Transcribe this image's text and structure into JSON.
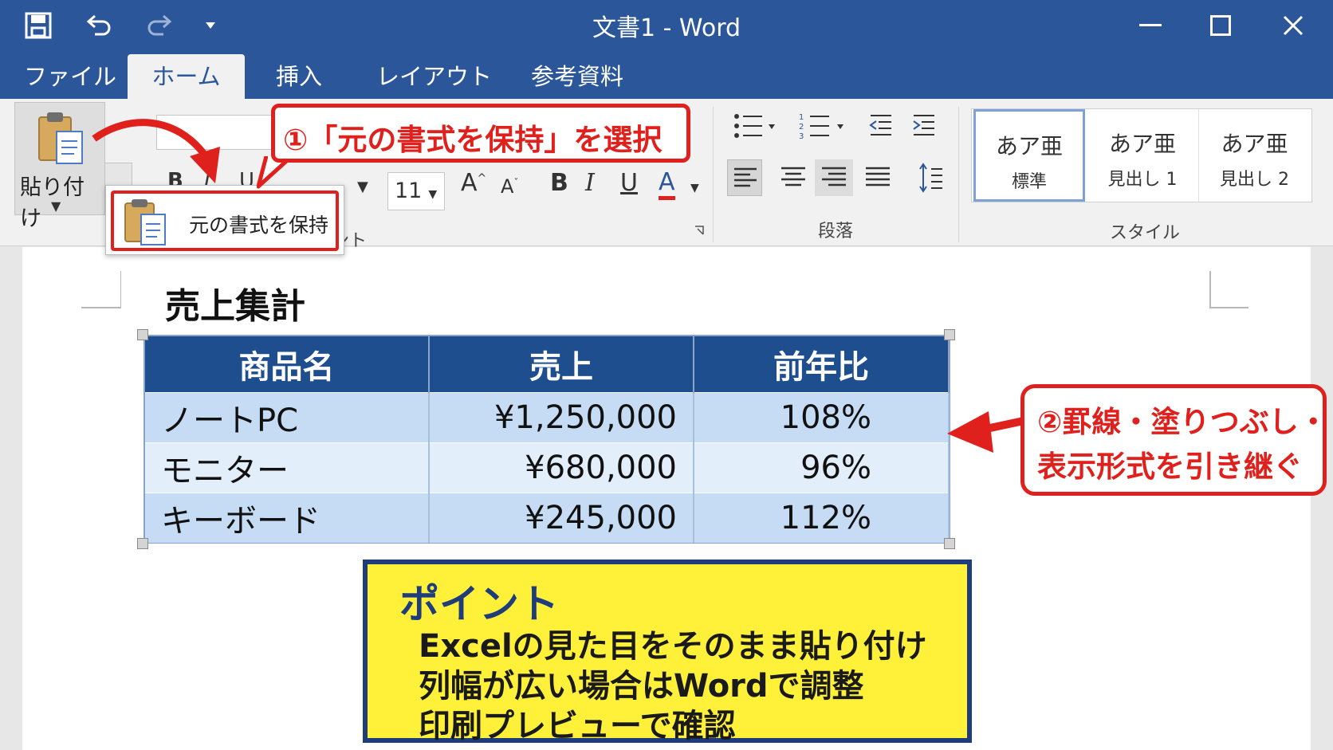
{
  "window": {
    "title": "文書1 - Word"
  },
  "tabs": [
    {
      "label": "ファイル"
    },
    {
      "label": "ホーム"
    },
    {
      "label": "挿入"
    },
    {
      "label": "レイアウト"
    },
    {
      "label": "参考資料"
    }
  ],
  "ribbon": {
    "paste_label": "貼り付け",
    "font_size": "11",
    "font_group_label": "ント",
    "paragraph_group_label": "段落",
    "styles_group_label": "スタイル",
    "styles": [
      {
        "sample": "あア亜",
        "name": "標準"
      },
      {
        "sample": "あア亜",
        "name": "見出し 1"
      },
      {
        "sample": "あア亜",
        "name": "見出し 2"
      }
    ],
    "format_buttons": {
      "bold": "B",
      "italic": "I",
      "underline": "U",
      "font_color": "A"
    }
  },
  "paste_popup": {
    "keep_format_label": "元の書式を保持"
  },
  "callouts": {
    "step1": "①「元の書式を保持」を選択",
    "step2_line1": "②罫線・塗りつぶし・",
    "step2_line2": "表示形式を引き継ぐ"
  },
  "document": {
    "title": "売上集計",
    "table": {
      "headers": [
        "商品名",
        "売上",
        "前年比"
      ],
      "rows": [
        [
          "ノートPC",
          "¥1,250,000",
          "108%"
        ],
        [
          "モニター",
          "¥680,000",
          "96%"
        ],
        [
          "キーボード",
          "¥245,000",
          "112%"
        ]
      ]
    }
  },
  "point": {
    "title": "ポイント",
    "lines": [
      "Excelの見た目をそのまま貼り付け",
      "列幅が広い場合はWordで調整",
      "印刷プレビューで確認"
    ]
  },
  "colors": {
    "word_blue": "#2b579a",
    "callout_red": "#e0201c",
    "header_navy": "#1f4e8f",
    "point_yellow": "#fff13a"
  }
}
